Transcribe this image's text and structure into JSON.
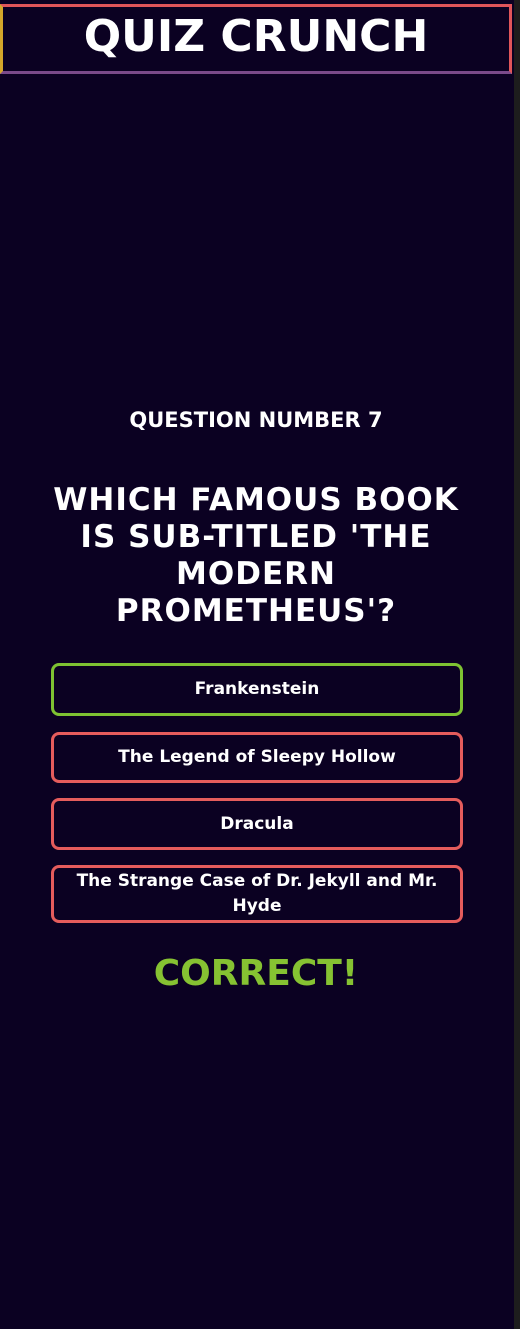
{
  "header": {
    "title": "QUIZ CRUNCH"
  },
  "quiz": {
    "question_number_label": "QUESTION NUMBER 7",
    "question": "WHICH FAMOUS BOOK IS SUB-TITLED 'THE MODERN PROMETHEUS'?",
    "answers": [
      {
        "label": "Frankenstein",
        "state": "correct"
      },
      {
        "label": "The Legend of Sleepy Hollow",
        "state": "incorrect"
      },
      {
        "label": "Dracula",
        "state": "incorrect"
      },
      {
        "label": "The Strange Case of Dr. Jekyll and Mr. Hyde",
        "state": "incorrect"
      }
    ],
    "result": "CORRECT!"
  },
  "colors": {
    "background": "#0b0122",
    "correct": "#7ec232",
    "incorrect": "#e55c5c",
    "result_text": "#86c232",
    "header_border_top": "#e0555a",
    "header_border_left": "#d4a62a",
    "header_border_bottom": "#7a4a8a"
  }
}
